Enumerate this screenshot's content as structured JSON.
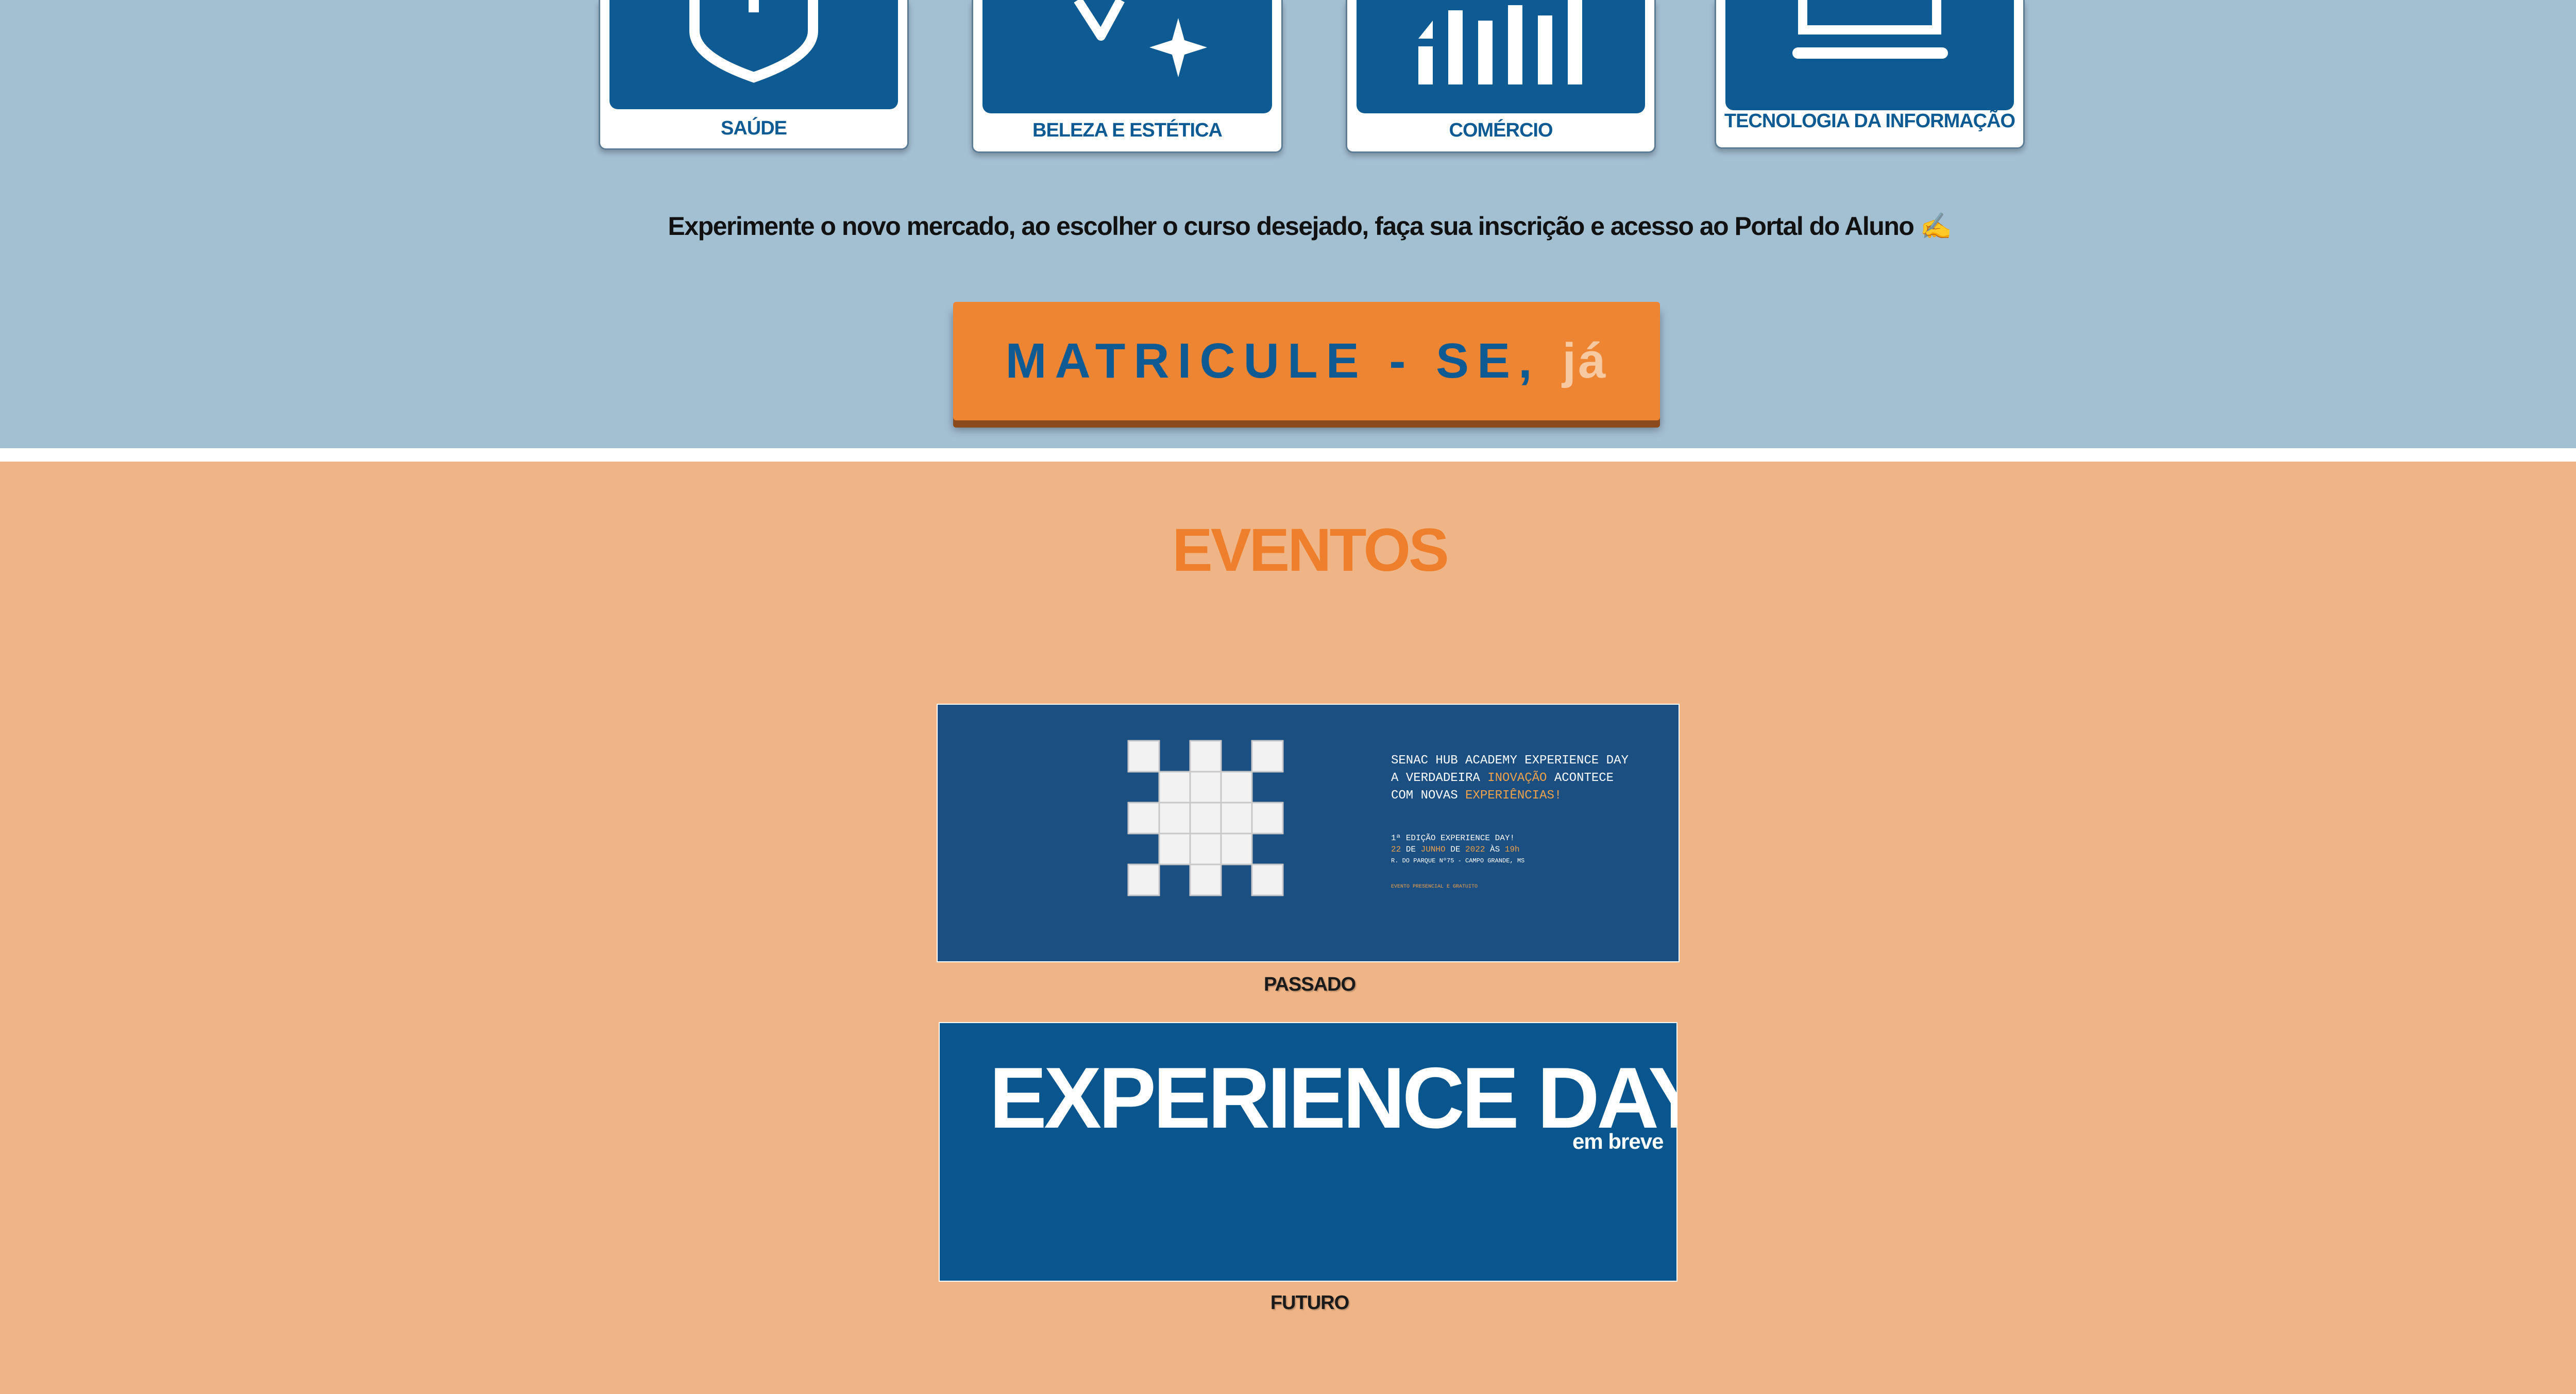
{
  "categories": [
    {
      "label": "SAÚDE",
      "icon": "shield-icon"
    },
    {
      "label": "BELEZA E ESTÉTICA",
      "icon": "sparkle-icon"
    },
    {
      "label": "COMÉRCIO",
      "icon": "bar-chart-icon"
    },
    {
      "label": "TECNOLOGIA DA INFORMAÇÃO",
      "icon": "laptop-icon"
    }
  ],
  "tagline": "Experimente o novo mercado, ao escolher o curso desejado, faça sua inscrição e acesso ao Portal do Aluno ✍",
  "cta": {
    "main": "MATRICULE - SE,",
    "accent": "já"
  },
  "events": {
    "title": "EVENTOS",
    "past": {
      "caption": "PASSADO",
      "line1": "SENAC HUB ACADEMY EXPERIENCE DAY",
      "line2_a": "A VERDADEIRA ",
      "line2_hl": "INOVAÇÃO",
      "line2_b": " ACONTECE",
      "line3_a": "COM NOVAS  ",
      "line3_hl": "EXPERIÊNCIAS!",
      "edition": "1ª EDIÇÃO EXPERIENCE DAY!",
      "date_day": "22",
      "date_de1": " DE ",
      "date_month": "JUNHO",
      "date_de2": " DE ",
      "date_year": "2022",
      "date_as": " ÀS ",
      "date_hour": "19h",
      "address": "R. DO PARQUE Nº75 - CAMPO GRANDE, MS",
      "note": "EVENTO PRESENCIAL E GRATUITO"
    },
    "future": {
      "caption": "FUTURO",
      "title": "EXPERIENCE DAY",
      "subtitle": "em breve"
    }
  },
  "colors": {
    "top_bg": "#a3bfd2",
    "events_bg": "#f0b587",
    "brand_blue": "#0e5b93",
    "cta_orange": "#ee8533",
    "events_title": "#ee7f2d"
  }
}
